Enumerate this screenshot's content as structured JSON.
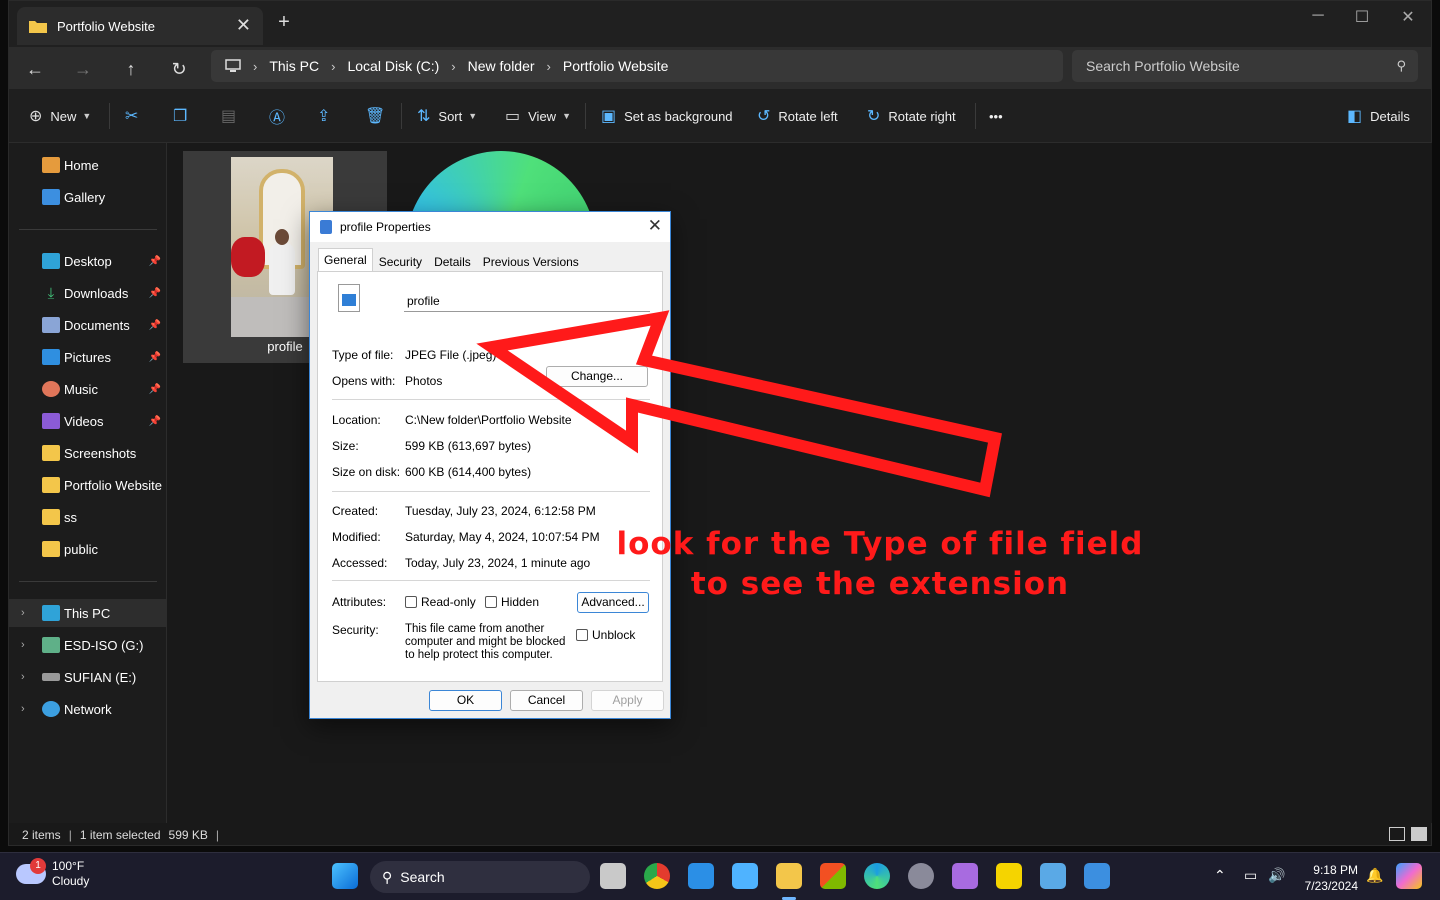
{
  "explorer": {
    "tab_title": "Portfolio Website",
    "tab_close": "✕",
    "tab_add": "+",
    "breadcrumb": [
      "This PC",
      "Local Disk (C:)",
      "New folder",
      "Portfolio Website"
    ],
    "search_placeholder": "Search Portfolio Website",
    "toolbar": {
      "new": "New",
      "sort": "Sort",
      "view": "View",
      "set_background": "Set as background",
      "rotate_left": "Rotate left",
      "rotate_right": "Rotate right",
      "more": "•••",
      "details": "Details"
    },
    "sidebar": {
      "quick": [
        "Home",
        "Gallery"
      ],
      "pinned": [
        "Desktop",
        "Downloads",
        "Documents",
        "Pictures",
        "Music",
        "Videos"
      ],
      "folders": [
        "Screenshots",
        "Portfolio Website",
        "ss",
        "public"
      ],
      "drives": [
        "This PC",
        "ESD-ISO (G:)",
        "SUFIAN (E:)",
        "Network"
      ]
    },
    "file_name": "profile",
    "status": {
      "items": "2 items",
      "selected": "1 item selected",
      "size": "599 KB"
    }
  },
  "dialog": {
    "title": "profile Properties",
    "close": "✕",
    "tabs": [
      "General",
      "Security",
      "Details",
      "Previous Versions"
    ],
    "name_value": "profile",
    "fields": {
      "type_label": "Type of file:",
      "type_value": "JPEG File (.jpeg)",
      "opens_label": "Opens with:",
      "opens_value": "Photos",
      "change_button": "Change...",
      "location_label": "Location:",
      "location_value": "C:\\New folder\\Portfolio Website",
      "size_label": "Size:",
      "size_value": "599 KB (613,697 bytes)",
      "size_disk_label": "Size on disk:",
      "size_disk_value": "600 KB (614,400 bytes)",
      "created_label": "Created:",
      "created_value": "Tuesday, July 23, 2024, 6:12:58 PM",
      "modified_label": "Modified:",
      "modified_value": "Saturday, May 4, 2024, 10:07:54 PM",
      "accessed_label": "Accessed:",
      "accessed_value": "Today, July 23, 2024, 1 minute ago",
      "attributes_label": "Attributes:",
      "readonly": "Read-only",
      "hidden": "Hidden",
      "advanced_button": "Advanced...",
      "security_label": "Security:",
      "security_value": "This file came from another computer and might be blocked to help protect this computer.",
      "unblock": "Unblock"
    },
    "buttons": {
      "ok": "OK",
      "cancel": "Cancel",
      "apply": "Apply"
    }
  },
  "annotation": {
    "line1": "look for the Type of file field",
    "line2": "to see the extension",
    "color": "#ff1a1a"
  },
  "taskbar": {
    "weather_badge": "1",
    "weather_temp": "100°F",
    "weather_cond": "Cloudy",
    "search_label": "Search",
    "time": "9:18 PM",
    "date": "7/23/2024"
  }
}
